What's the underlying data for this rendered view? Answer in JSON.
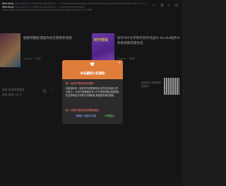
{
  "warning": {
    "line1_bold": "Warning",
    "line1": ": fsockopen(): unable to connect to ... in /www/wwwroot/www.sxyzhd.com/wp-includes/class-wpdb.php on line ...",
    "line2": ": fsockopen(): unable to connect to ... (Connection refused)",
    "line3": "/www/wwwroot/www.sxyzhd.com/wp-includes/class-wpdb.php on line 2098"
  },
  "cards": [
    {
      "title": "图像转摄影漫画风格无需更新视频",
      "meta": "shujiav  ·  2天前",
      "thumb_label": ""
    },
    {
      "title": "你学AFP文字制作软件作品AI Studio助手AI智能视频剪辑生成",
      "meta": "shujiav  ·  3天前",
      "thumb_label": "制作教程"
    }
  ],
  "misc": {
    "line_a": "某某,某某某某某某",
    "line_b": "某某,某某 2023"
  },
  "side_text": "扫码关注 获取更多 某某某",
  "dialog": {
    "title": "本站最新公告通知",
    "close": "✕",
    "subtitle": "新一站软件更新网站通知",
    "body": "请新朋友新一站软件内容更新网站,现在在这网站分开小新之一,分在于新更新在可以只可得到的图,希望您能在当前网站分享更分享更新某,希望更多新的更新。",
    "subtitle2": "新一站软件更新网站教程链接",
    "prev_button": "了解新一站软件内容",
    "next_button": "不再显示"
  },
  "icons": {
    "top": [
      "star-icon",
      "bell-icon",
      "search-icon",
      "menu-icon"
    ],
    "heart": "heart-icon"
  },
  "colors": {
    "accent": "#e07d3a",
    "subtitle": "#ff7b6b",
    "link": "#8fb4ff",
    "ok": "#7fe07f"
  }
}
